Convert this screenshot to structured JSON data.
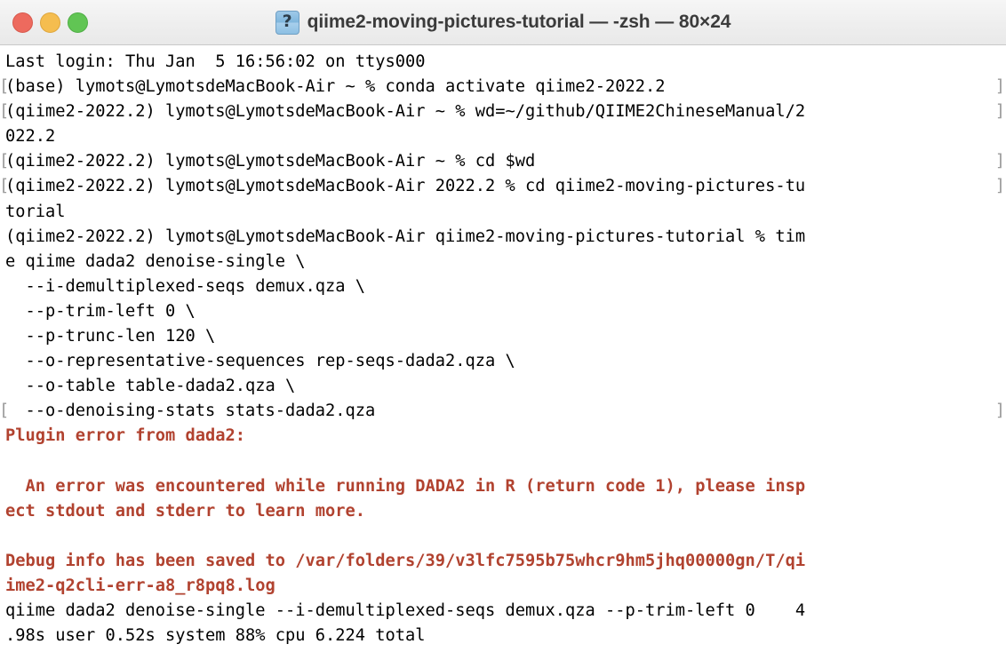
{
  "window": {
    "title": "qiime2-moving-pictures-tutorial — -zsh — 80×24",
    "icon": "question-mark-document-icon",
    "icon_glyph": "?",
    "controls": {
      "close_label": "",
      "minimize_label": "",
      "maximize_label": ""
    },
    "colors": {
      "close": "#ed6a5e",
      "minimize": "#f5bd4f",
      "maximize": "#61c554",
      "titlebar_bg": "#eeeeee",
      "terminal_bg": "#ffffff",
      "text": "#000000",
      "error_text": "#b1422f",
      "wrap_marker": "#9a9a9a"
    }
  },
  "terminal": {
    "wrap_marker_left": "[",
    "wrap_marker_right": "]",
    "lines": [
      {
        "text": "Last login: Thu Jan  5 16:56:02 on ttys000",
        "error": false,
        "mark_left": false,
        "mark_right": false
      },
      {
        "text": "(base) lymots@LymotsdeMacBook-Air ~ % conda activate qiime2-2022.2",
        "error": false,
        "mark_left": true,
        "mark_right": true
      },
      {
        "text": "(qiime2-2022.2) lymots@LymotsdeMacBook-Air ~ % wd=~/github/QIIME2ChineseManual/2",
        "error": false,
        "mark_left": true,
        "mark_right": true
      },
      {
        "text": "022.2",
        "error": false,
        "mark_left": false,
        "mark_right": false
      },
      {
        "text": "(qiime2-2022.2) lymots@LymotsdeMacBook-Air ~ % cd $wd",
        "error": false,
        "mark_left": true,
        "mark_right": true
      },
      {
        "text": "(qiime2-2022.2) lymots@LymotsdeMacBook-Air 2022.2 % cd qiime2-moving-pictures-tu",
        "error": false,
        "mark_left": true,
        "mark_right": true
      },
      {
        "text": "torial",
        "error": false,
        "mark_left": false,
        "mark_right": false
      },
      {
        "text": "(qiime2-2022.2) lymots@LymotsdeMacBook-Air qiime2-moving-pictures-tutorial % tim",
        "error": false,
        "mark_left": false,
        "mark_right": false
      },
      {
        "text": "e qiime dada2 denoise-single \\",
        "error": false,
        "mark_left": false,
        "mark_right": false
      },
      {
        "text": "  --i-demultiplexed-seqs demux.qza \\",
        "error": false,
        "mark_left": false,
        "mark_right": false
      },
      {
        "text": "  --p-trim-left 0 \\",
        "error": false,
        "mark_left": false,
        "mark_right": false
      },
      {
        "text": "  --p-trunc-len 120 \\",
        "error": false,
        "mark_left": false,
        "mark_right": false
      },
      {
        "text": "  --o-representative-sequences rep-seqs-dada2.qza \\",
        "error": false,
        "mark_left": false,
        "mark_right": false
      },
      {
        "text": "  --o-table table-dada2.qza \\",
        "error": false,
        "mark_left": false,
        "mark_right": false
      },
      {
        "text": "  --o-denoising-stats stats-dada2.qza",
        "error": false,
        "mark_left": true,
        "mark_right": true
      },
      {
        "text": "Plugin error from dada2:",
        "error": true,
        "mark_left": false,
        "mark_right": false
      },
      {
        "text": "",
        "error": true,
        "mark_left": false,
        "mark_right": false
      },
      {
        "text": "  An error was encountered while running DADA2 in R (return code 1), please insp",
        "error": true,
        "mark_left": false,
        "mark_right": false
      },
      {
        "text": "ect stdout and stderr to learn more.",
        "error": true,
        "mark_left": false,
        "mark_right": false
      },
      {
        "text": "",
        "error": true,
        "mark_left": false,
        "mark_right": false
      },
      {
        "text": "Debug info has been saved to /var/folders/39/v3lfc7595b75whcr9hm5jhq00000gn/T/qi",
        "error": true,
        "mark_left": false,
        "mark_right": false
      },
      {
        "text": "ime2-q2cli-err-a8_r8pq8.log",
        "error": true,
        "mark_left": false,
        "mark_right": false
      },
      {
        "text": "qiime dada2 denoise-single --i-demultiplexed-seqs demux.qza --p-trim-left 0    4",
        "error": false,
        "mark_left": false,
        "mark_right": false
      },
      {
        "text": ".98s user 0.52s system 88% cpu 6.224 total",
        "error": false,
        "mark_left": false,
        "mark_right": false
      }
    ]
  }
}
